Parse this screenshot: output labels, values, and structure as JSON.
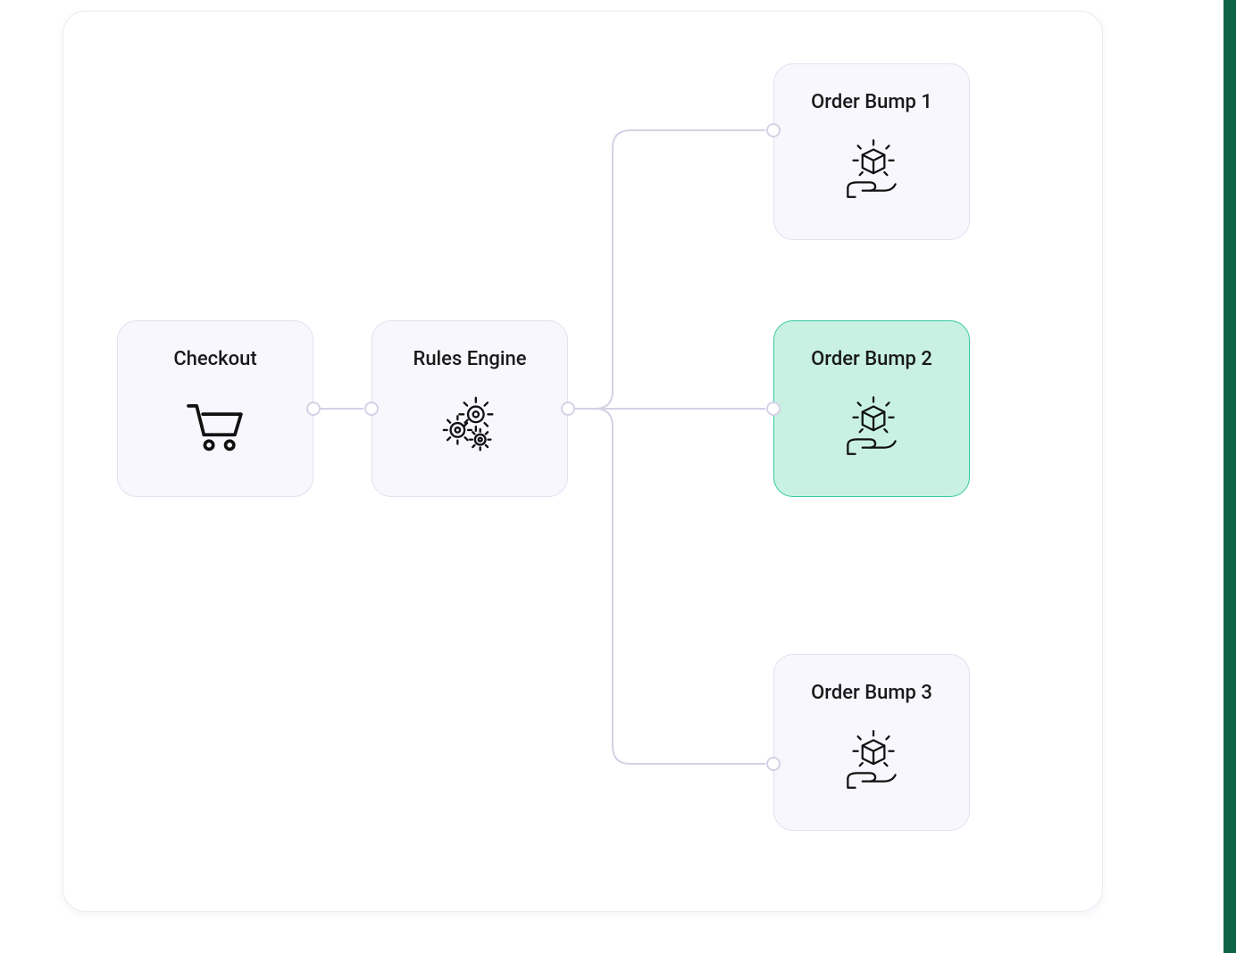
{
  "nodes": {
    "checkout": {
      "label": "Checkout",
      "icon": "cart-icon"
    },
    "rules": {
      "label": "Rules Engine",
      "icon": "gears-icon"
    },
    "bump1": {
      "label": "Order Bump 1",
      "icon": "hand-box-icon"
    },
    "bump2": {
      "label": "Order Bump 2",
      "icon": "hand-box-icon",
      "highlight": true
    },
    "bump3": {
      "label": "Order Bump 3",
      "icon": "hand-box-icon"
    }
  },
  "colors": {
    "node_bg": "#f8f7fd",
    "node_border": "#e3e0f0",
    "highlight_bg": "#c9f1e3",
    "highlight_border": "#34c9a3",
    "connector": "#d5d1e6"
  }
}
